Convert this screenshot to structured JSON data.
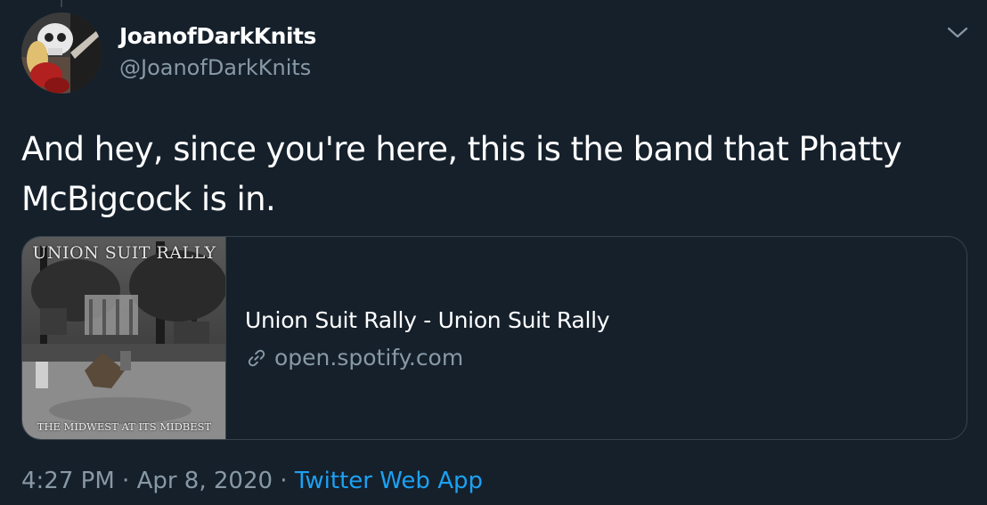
{
  "tweet": {
    "display_name": "JoanofDarkKnits",
    "handle": "@JoanofDarkKnits",
    "text": "And hey, since you're here, this is the band that Phatty McBigcock is in.",
    "card": {
      "album_cover_title": "UNION SUIT RALLY",
      "album_cover_subtitle": "THE MIDWEST AT ITS MIDBEST",
      "title": "Union Suit Rally - Union Suit Rally",
      "url": "open.spotify.com",
      "url_icon": "link-icon"
    },
    "time": "4:27 PM",
    "separator_1": " · ",
    "date": "Apr 8, 2020",
    "separator_2": " · ",
    "source": "Twitter Web App"
  },
  "icons": {
    "caret": "chevron-down-icon",
    "link": "link-icon"
  },
  "colors": {
    "background": "#15202b",
    "primary_text": "#ffffff",
    "secondary_text": "#8899a6",
    "border": "#38444d",
    "accent": "#1da1f2"
  }
}
